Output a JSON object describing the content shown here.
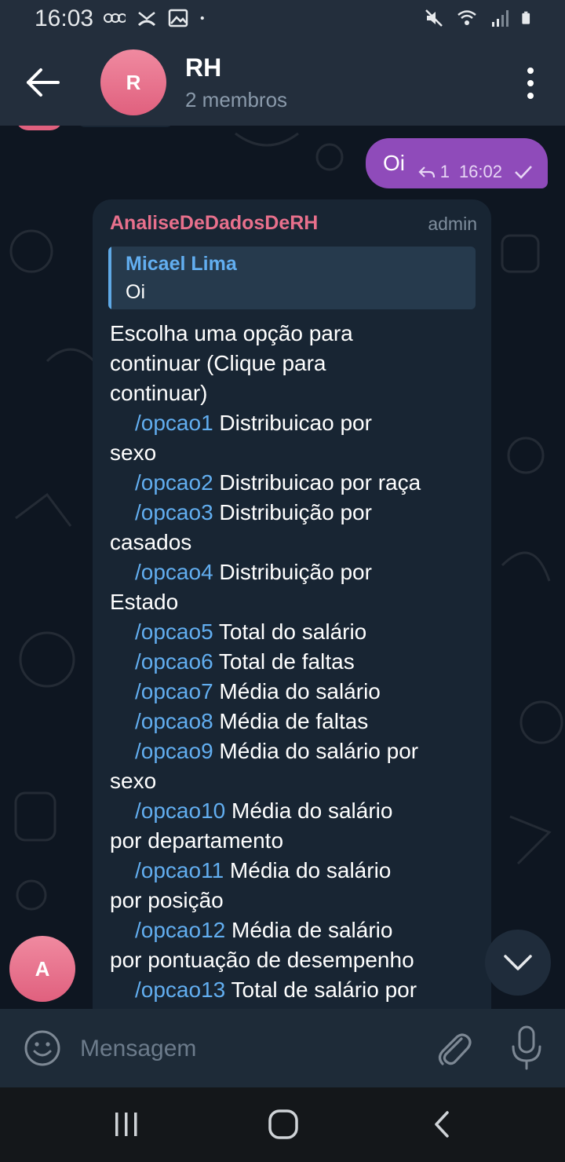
{
  "status_bar": {
    "time": "16:03",
    "left_icons": [
      "vodafone-icon",
      "missed-call-icon",
      "image-icon",
      "dot-icon"
    ],
    "right_icons": [
      "mute-icon",
      "wifi-icon",
      "signal-icon",
      "battery-icon"
    ]
  },
  "header": {
    "title": "RH",
    "subtitle": "2 membros",
    "avatar_letter": "R",
    "back_icon": "arrow-left-icon",
    "menu_icon": "more-vertical-icon"
  },
  "messages": {
    "outgoing": {
      "text": "Oi",
      "reply_count": "1",
      "time": "16:02",
      "status_icon": "check-icon"
    },
    "incoming": {
      "sender": "AnaliseDeDadosDeRH",
      "role": "admin",
      "reply_to": {
        "name": "Micael Lima",
        "text": "Oi"
      },
      "intro": [
        "Escolha uma opção para",
        "continuar (Clique para",
        "continuar)"
      ],
      "options": [
        {
          "cmd": "/opcao1",
          "desc": "Distribuicao por",
          "cont": "sexo"
        },
        {
          "cmd": "/opcao2",
          "desc": "Distribuicao por raça",
          "cont": ""
        },
        {
          "cmd": "/opcao3",
          "desc": "Distribuição por",
          "cont": "casados"
        },
        {
          "cmd": "/opcao4",
          "desc": "Distribuição por",
          "cont": "Estado"
        },
        {
          "cmd": "/opcao5",
          "desc": "Total do salário",
          "cont": ""
        },
        {
          "cmd": "/opcao6",
          "desc": "Total de faltas",
          "cont": ""
        },
        {
          "cmd": "/opcao7",
          "desc": "Média do salário",
          "cont": ""
        },
        {
          "cmd": "/opcao8",
          "desc": "Média de faltas",
          "cont": ""
        },
        {
          "cmd": "/opcao9",
          "desc": "Média do salário por",
          "cont": "sexo"
        },
        {
          "cmd": "/opcao10",
          "desc": "Média do salário",
          "cont": "por departamento"
        },
        {
          "cmd": "/opcao11",
          "desc": "Média do salário",
          "cont": "por posição"
        },
        {
          "cmd": "/opcao12",
          "desc": "Média de salário",
          "cont": "por pontuação de desempenho"
        },
        {
          "cmd": "/opcao13",
          "desc": "Total de salário por",
          "cont": ""
        }
      ]
    },
    "side_avatar_letter": "A"
  },
  "input": {
    "placeholder": "Mensagem",
    "emoji_icon": "emoji-icon",
    "attach_icon": "paperclip-icon",
    "mic_icon": "microphone-icon"
  },
  "scroll_down_icon": "chevron-down-icon",
  "nav": [
    "recent-apps-icon",
    "home-icon",
    "back-icon"
  ],
  "colors": {
    "header_bg": "#232e3c",
    "chat_bg": "#0e1621",
    "outgoing_bubble": "#8f4bba",
    "incoming_bubble": "#182533",
    "link": "#62aef0",
    "sender_name": "#e8708c",
    "avatar": "#e0607e"
  }
}
